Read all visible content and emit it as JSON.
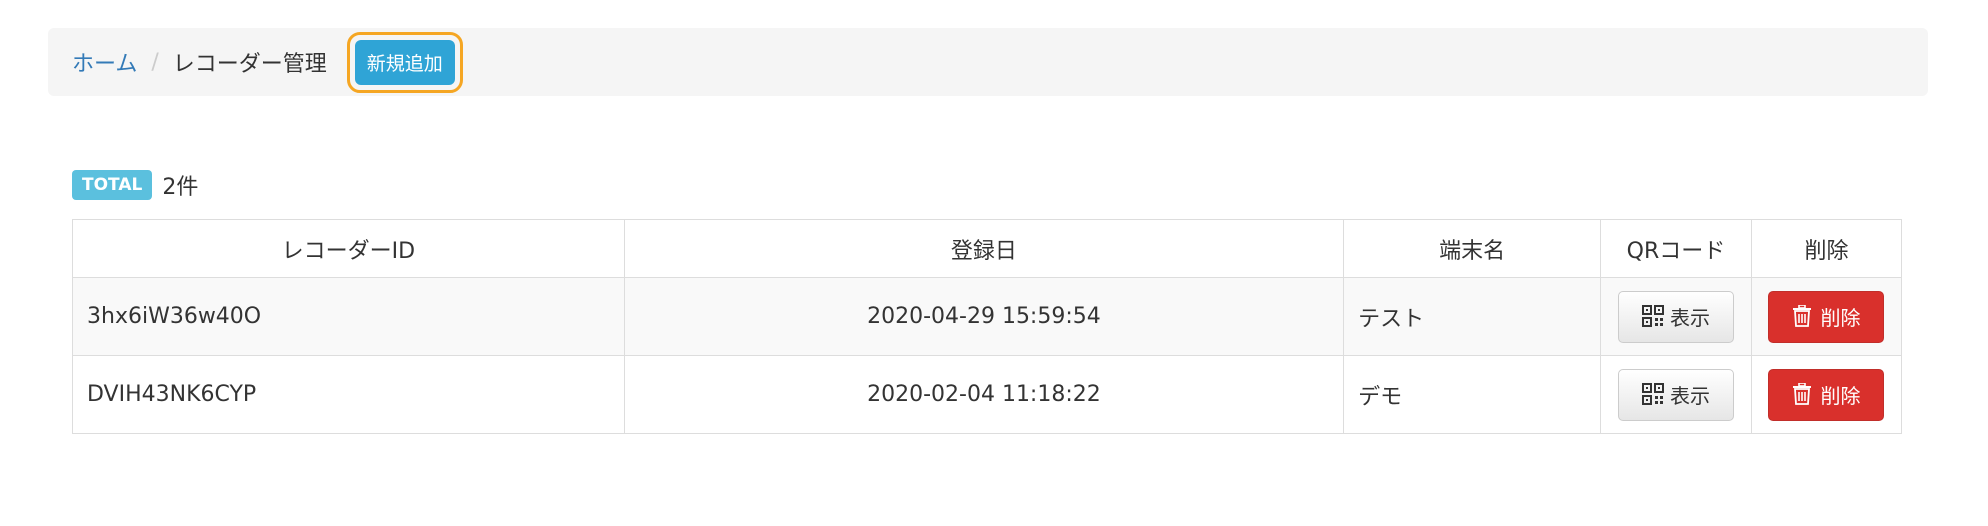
{
  "breadcrumb": {
    "home": "ホーム",
    "separator": "/",
    "current": "レコーダー管理",
    "add_label": "新規追加"
  },
  "total": {
    "badge": "TOTAL",
    "count": "2件"
  },
  "table": {
    "headers": {
      "id": "レコーダーID",
      "date": "登録日",
      "name": "端末名",
      "qr": "QRコード",
      "delete": "削除"
    },
    "rows": [
      {
        "id": "3hx6iW36w40O",
        "date": "2020-04-29 15:59:54",
        "name": "テスト",
        "qr_label": "表示",
        "delete_label": "削除"
      },
      {
        "id": "DVIH43NK6CYP",
        "date": "2020-02-04 11:18:22",
        "name": "デモ",
        "qr_label": "表示",
        "delete_label": "削除"
      }
    ]
  },
  "icons": {
    "qr": "qrcode-icon",
    "delete": "trash-icon"
  },
  "colors": {
    "link": "#337ab7",
    "add_button": "#2fa4d6",
    "highlight_ring": "#f5a623",
    "total_badge": "#5bc0de",
    "delete_button": "#d9302c"
  }
}
